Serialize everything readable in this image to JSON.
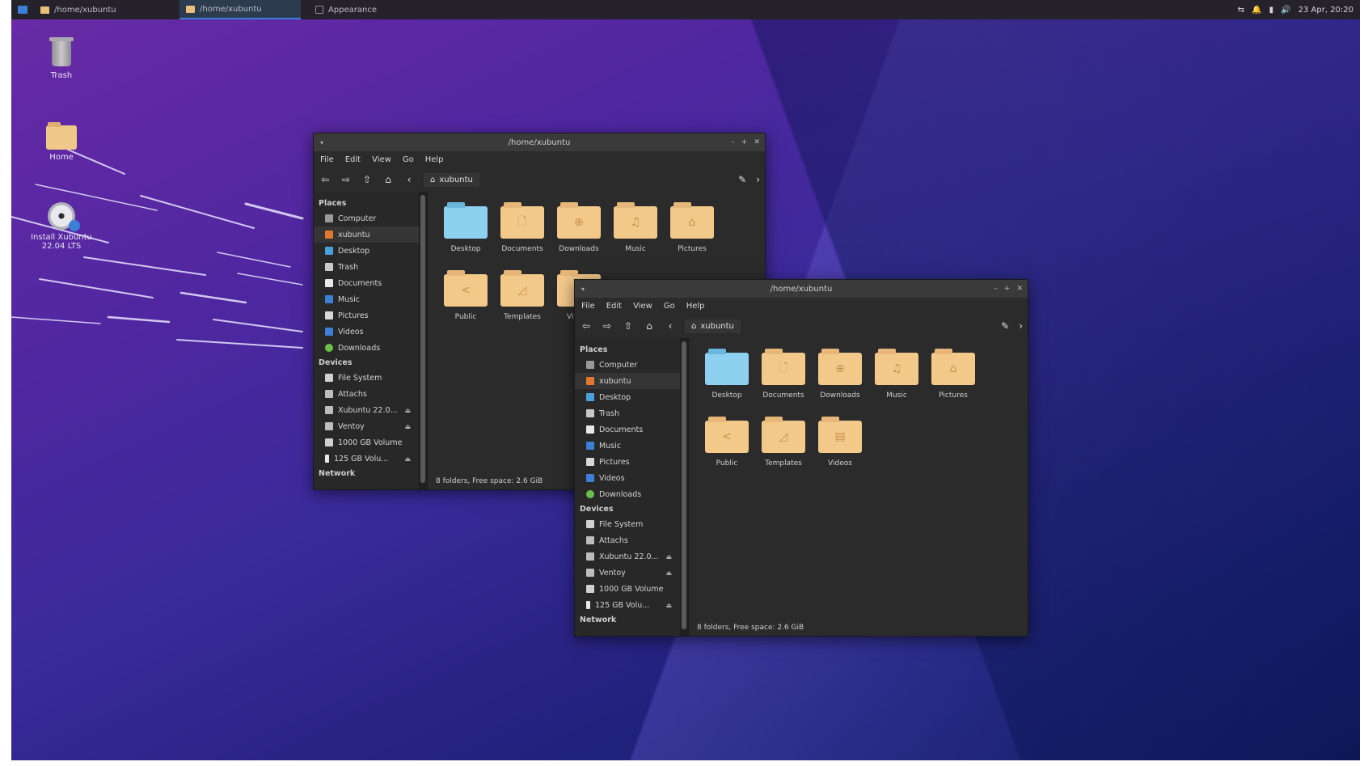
{
  "panel": {
    "tasks": [
      {
        "label": "/home/xubuntu"
      },
      {
        "label": "/home/xubuntu"
      },
      {
        "label": "Appearance"
      }
    ],
    "datetime": "23 Apr, 20:20"
  },
  "desktop": {
    "icons": [
      {
        "label": "Trash"
      },
      {
        "label": "Home"
      },
      {
        "label": "Install Xubuntu 22.04 LTS"
      }
    ]
  },
  "window": {
    "title": "/home/xubuntu",
    "menu": [
      "File",
      "Edit",
      "View",
      "Go",
      "Help"
    ],
    "breadcrumb": "xubuntu",
    "sidebar": {
      "places_header": "Places",
      "places": [
        {
          "label": "Computer",
          "color": "#9a9a9a"
        },
        {
          "label": "xubuntu",
          "color": "#e0782f"
        },
        {
          "label": "Desktop",
          "color": "#4aa0d8"
        },
        {
          "label": "Trash",
          "color": "#c8c8c8"
        },
        {
          "label": "Documents",
          "color": "#e8e8e8"
        },
        {
          "label": "Music",
          "color": "#3b7fd6"
        },
        {
          "label": "Pictures",
          "color": "#d8d8d8"
        },
        {
          "label": "Videos",
          "color": "#3b7fd6"
        },
        {
          "label": "Downloads",
          "color": "#6cc04a"
        }
      ],
      "devices_header": "Devices",
      "devices": [
        {
          "label": "File System",
          "eject": ""
        },
        {
          "label": "Attachs",
          "eject": ""
        },
        {
          "label": "Xubuntu 22.0...",
          "eject": "⏏"
        },
        {
          "label": "Ventoy",
          "eject": "⏏"
        },
        {
          "label": "1000 GB Volume",
          "eject": ""
        },
        {
          "label": "125 GB Volu...",
          "eject": "⏏"
        }
      ],
      "network_header": "Network"
    },
    "files": [
      {
        "name": "Desktop",
        "icon": "desktop-folder-icon",
        "glyph": ""
      },
      {
        "name": "Documents",
        "icon": "documents-folder-icon",
        "glyph": "🗋"
      },
      {
        "name": "Downloads",
        "icon": "downloads-folder-icon",
        "glyph": "⊕"
      },
      {
        "name": "Music",
        "icon": "music-folder-icon",
        "glyph": "♫"
      },
      {
        "name": "Pictures",
        "icon": "pictures-folder-icon",
        "glyph": "⌂"
      },
      {
        "name": "Public",
        "icon": "public-folder-icon",
        "glyph": "<"
      },
      {
        "name": "Templates",
        "icon": "templates-folder-icon",
        "glyph": "◿"
      },
      {
        "name": "Videos",
        "icon": "videos-folder-icon",
        "glyph": "▤"
      }
    ],
    "status": "8 folders, Free space: 2.6 GiB"
  }
}
